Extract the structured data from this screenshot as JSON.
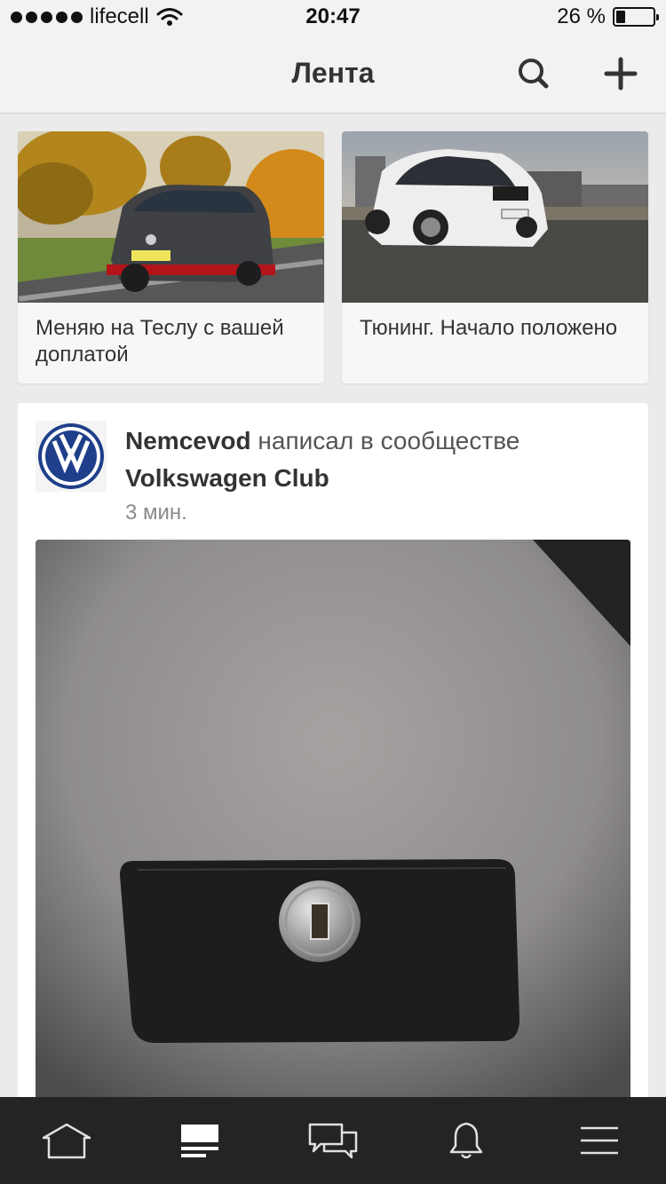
{
  "status_bar": {
    "carrier": "lifecell",
    "time": "20:47",
    "battery_percent": "26 %",
    "battery_level": 0.26
  },
  "nav": {
    "title": "Лента",
    "search_icon": "search-icon",
    "add_icon": "plus-icon"
  },
  "featured": [
    {
      "title": "Меняю на Теслу с вашей доплатой"
    },
    {
      "title": "Тюнинг. Начало положено"
    }
  ],
  "post": {
    "author": "Nemcevod",
    "action": " написал в сообществе ",
    "community": "Volkswagen Club",
    "time": "3 мин."
  },
  "tab_bar": {
    "items": [
      "home-icon",
      "feed-icon",
      "messages-icon",
      "bell-icon",
      "menu-icon"
    ],
    "active_index": 1
  },
  "colors": {
    "background": "#ebebeb",
    "nav_bg": "#f2f2f2",
    "tab_bar_bg": "#242424",
    "vw_blue": "#1f3f8a"
  }
}
